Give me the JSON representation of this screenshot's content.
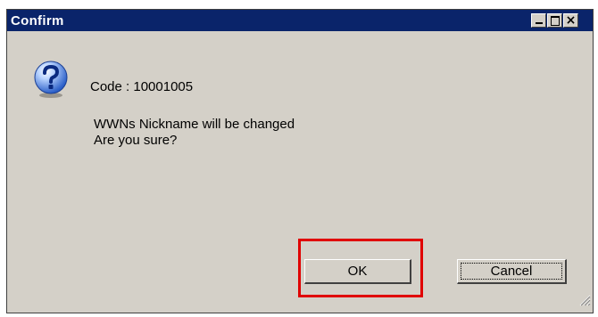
{
  "window": {
    "title": "Confirm",
    "titlebar_color": "#0a246a"
  },
  "titlebar_buttons": {
    "minimize_icon": "minimize-icon",
    "maximize_icon": "maximize-icon",
    "close_glyph": "×"
  },
  "dialog": {
    "icon": "question-icon",
    "code_text": "Code : 10001005",
    "message_line1": "WWNs Nickname will be changed",
    "message_line2": "Are you sure?"
  },
  "buttons": {
    "ok_label": "OK",
    "cancel_label": "Cancel"
  },
  "annotation": {
    "highlight_color": "#e00000"
  }
}
